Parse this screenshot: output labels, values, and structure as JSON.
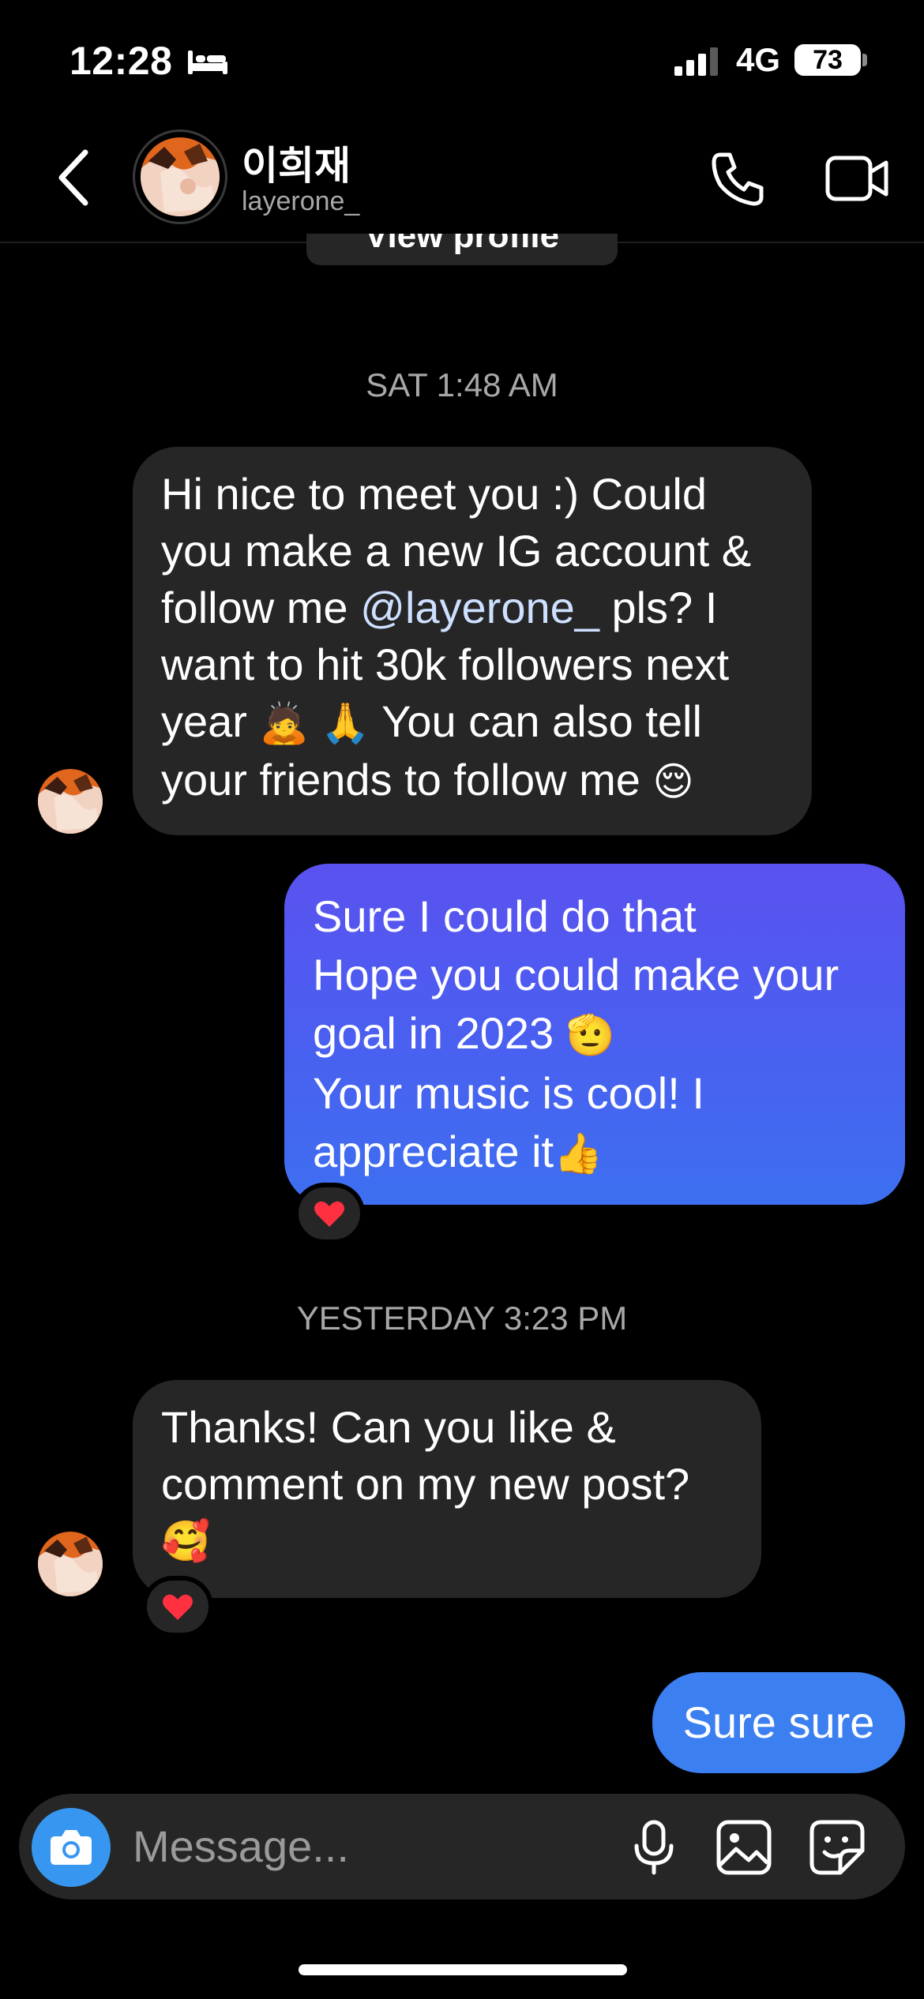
{
  "status_bar": {
    "time": "12:28",
    "network": "4G",
    "battery": "73"
  },
  "header": {
    "name": "이희재",
    "username": "layerone_",
    "view_profile_label": "View profile"
  },
  "timestamps": {
    "first": "SAT 1:48 AM",
    "second": "YESTERDAY 3:23 PM"
  },
  "messages": {
    "m1": {
      "lines": [
        "Hi nice to meet you :) Could",
        "you make a new IG account &",
        "follow me ",
        "want to hit 30k followers next",
        "year ",
        "your friends to follow me "
      ],
      "mention": "@layerone_",
      "after_mention": " pls? I",
      "year_tail": " You can also tell",
      "emoji_bow": "🙇",
      "emoji_pray": "🙏",
      "emoji_relieved": "😌"
    },
    "m2": {
      "lines": [
        "Sure I could do that",
        "Hope you could make your",
        "goal in 2023 ",
        "Your music is cool! I",
        "appreciate it"
      ],
      "emoji_point": "🫡",
      "emoji_thumb": "👍",
      "reaction": "❤️"
    },
    "m3": {
      "lines": [
        "Thanks! Can you like &",
        "comment on my new post?"
      ],
      "emoji": "🥰",
      "reaction": "❤️"
    },
    "m4": {
      "text": "Sure sure"
    }
  },
  "composer": {
    "placeholder": "Message..."
  },
  "colors": {
    "background": "#000000",
    "incoming_bubble": "#262626",
    "outgoing_gradient_top": "#5a52ef",
    "outgoing_gradient_bottom": "#3d6ff0",
    "outgoing_bubble": "#3b7ff0",
    "camera_button": "#3797f0",
    "reaction_heart": "#ff3040"
  },
  "icons": {
    "back": "chevron-left-icon",
    "call": "phone-icon",
    "video": "video-camera-icon",
    "camera": "camera-icon",
    "mic": "microphone-icon",
    "gallery": "image-icon",
    "sticker": "sticker-icon",
    "sleep": "bed-icon",
    "signal": "cellular-signal-icon"
  }
}
